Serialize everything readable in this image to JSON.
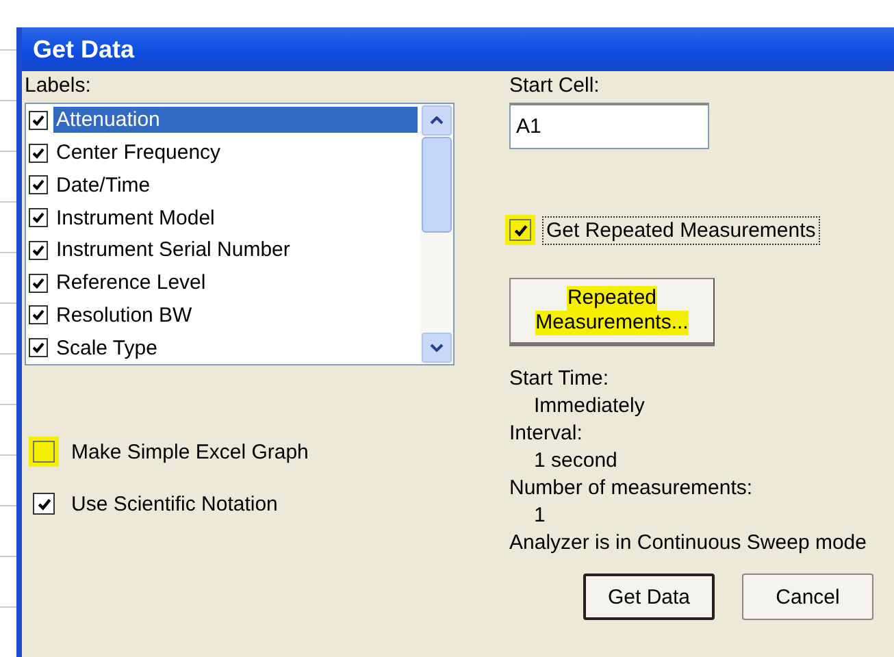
{
  "window": {
    "title": "Get Data"
  },
  "labels": {
    "caption": "Labels:",
    "items": [
      {
        "label": "Attenuation",
        "checked": true,
        "selected": true
      },
      {
        "label": "Center Frequency",
        "checked": true,
        "selected": false
      },
      {
        "label": "Date/Time",
        "checked": true,
        "selected": false
      },
      {
        "label": "Instrument Model",
        "checked": true,
        "selected": false
      },
      {
        "label": "Instrument Serial Number",
        "checked": true,
        "selected": false
      },
      {
        "label": "Reference Level",
        "checked": true,
        "selected": false
      },
      {
        "label": "Resolution BW",
        "checked": true,
        "selected": false
      },
      {
        "label": "Scale Type",
        "checked": true,
        "selected": false
      }
    ]
  },
  "options": [
    {
      "label": "Make Simple Excel Graph",
      "checked": false,
      "highlighted": true
    },
    {
      "label": "Use Scientific Notation",
      "checked": true,
      "highlighted": false
    }
  ],
  "start_cell": {
    "label": "Start Cell:",
    "value": "A1"
  },
  "repeat": {
    "label": "Get Repeated Measurements",
    "checked": true,
    "highlighted": true,
    "focused": true
  },
  "repeat_button": {
    "lines": [
      "Repeated",
      "Measurements..."
    ],
    "highlighted": true
  },
  "info": [
    {
      "text": "Start Time:",
      "indented": false
    },
    {
      "text": "Immediately",
      "indented": true
    },
    {
      "text": "Interval:",
      "indented": false
    },
    {
      "text": "1 second",
      "indented": true
    },
    {
      "text": "Number of measurements:",
      "indented": false
    },
    {
      "text": "1",
      "indented": true
    },
    {
      "text": "Analyzer is in Continuous Sweep mode",
      "indented": false
    }
  ],
  "buttons": [
    {
      "label": "Get Data",
      "default": true
    },
    {
      "label": "Cancel",
      "default": false
    }
  ]
}
